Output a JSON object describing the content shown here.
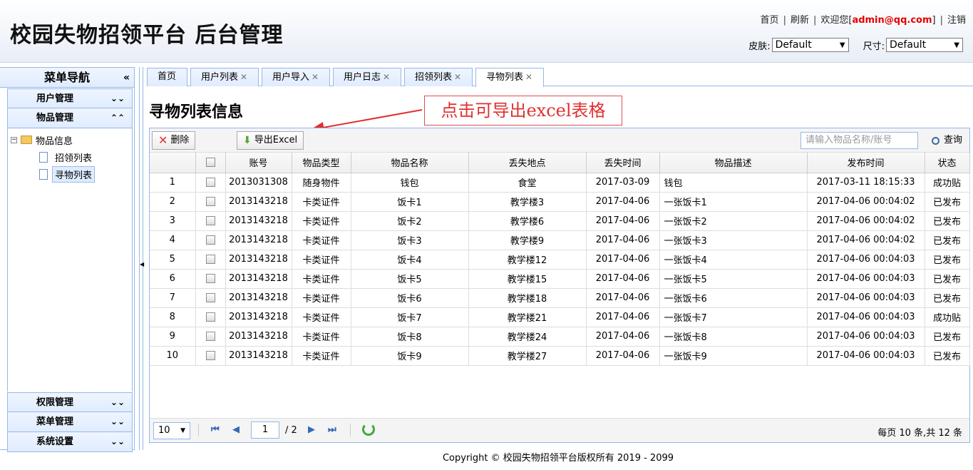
{
  "header": {
    "brand": "校园失物招领平台 后台管理",
    "links": {
      "home": "首页",
      "refresh": "刷新",
      "welcome_prefix": "欢迎您[",
      "email": "admin@qq.com",
      "welcome_suffix": "]",
      "logout": "注销"
    },
    "skin_label": "皮肤:",
    "skin_value": "Default",
    "size_label": "尺寸:",
    "size_value": "Default"
  },
  "nav": {
    "title": "菜单导航",
    "sections": {
      "users": "用户管理",
      "items": "物品管理",
      "perm": "权限管理",
      "menu": "菜单管理",
      "sys": "系统设置"
    },
    "tree": {
      "root": "物品信息",
      "leaf1": "招领列表",
      "leaf2": "寻物列表"
    }
  },
  "tabs": [
    {
      "label": "首页"
    },
    {
      "label": "用户列表"
    },
    {
      "label": "用户导入"
    },
    {
      "label": "用户日志"
    },
    {
      "label": "招领列表"
    },
    {
      "label": "寻物列表"
    }
  ],
  "main": {
    "title": "寻物列表信息",
    "annotation": "点击可导出excel表格",
    "delete_label": "删除",
    "export_label": "导出Excel",
    "search_placeholder": "请输入物品名称/账号",
    "query_label": "查询"
  },
  "table": {
    "headers": [
      "账号",
      "物品类型",
      "物品名称",
      "丢失地点",
      "丢失时间",
      "物品描述",
      "发布时间",
      "状态"
    ],
    "rows": [
      [
        "1",
        "2013031308",
        "随身物件",
        "钱包",
        "食堂",
        "2017-03-09",
        "钱包",
        "2017-03-11 18:15:33",
        "成功贴"
      ],
      [
        "2",
        "2013143218",
        "卡类证件",
        "饭卡1",
        "教学楼3",
        "2017-04-06",
        "一张饭卡1",
        "2017-04-06 00:04:02",
        "已发布"
      ],
      [
        "3",
        "2013143218",
        "卡类证件",
        "饭卡2",
        "教学楼6",
        "2017-04-06",
        "一张饭卡2",
        "2017-04-06 00:04:02",
        "已发布"
      ],
      [
        "4",
        "2013143218",
        "卡类证件",
        "饭卡3",
        "教学楼9",
        "2017-04-06",
        "一张饭卡3",
        "2017-04-06 00:04:02",
        "已发布"
      ],
      [
        "5",
        "2013143218",
        "卡类证件",
        "饭卡4",
        "教学楼12",
        "2017-04-06",
        "一张饭卡4",
        "2017-04-06 00:04:03",
        "已发布"
      ],
      [
        "6",
        "2013143218",
        "卡类证件",
        "饭卡5",
        "教学楼15",
        "2017-04-06",
        "一张饭卡5",
        "2017-04-06 00:04:03",
        "已发布"
      ],
      [
        "7",
        "2013143218",
        "卡类证件",
        "饭卡6",
        "教学楼18",
        "2017-04-06",
        "一张饭卡6",
        "2017-04-06 00:04:03",
        "已发布"
      ],
      [
        "8",
        "2013143218",
        "卡类证件",
        "饭卡7",
        "教学楼21",
        "2017-04-06",
        "一张饭卡7",
        "2017-04-06 00:04:03",
        "成功贴"
      ],
      [
        "9",
        "2013143218",
        "卡类证件",
        "饭卡8",
        "教学楼24",
        "2017-04-06",
        "一张饭卡8",
        "2017-04-06 00:04:03",
        "已发布"
      ],
      [
        "10",
        "2013143218",
        "卡类证件",
        "饭卡9",
        "教学楼27",
        "2017-04-06",
        "一张饭卡9",
        "2017-04-06 00:04:03",
        "已发布"
      ]
    ]
  },
  "pager": {
    "page_size": "10",
    "current_page": "1",
    "total_pages": "/ 2",
    "info": "每页 10 条,共 12 条"
  },
  "footer": "Copyright © 校园失物招领平台版权所有  2019 - 2099"
}
